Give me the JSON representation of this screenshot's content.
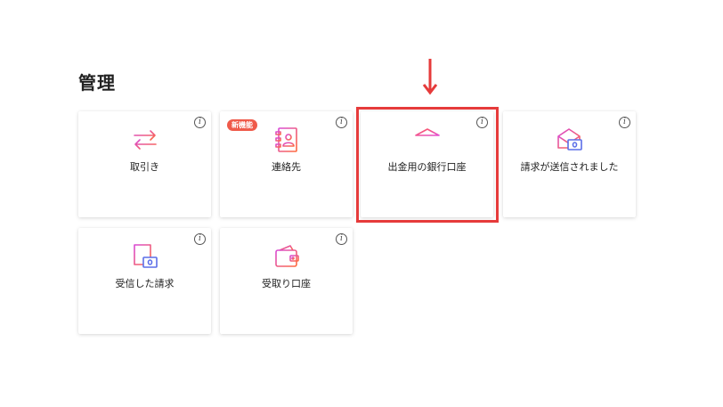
{
  "section": {
    "title": "管理"
  },
  "cards": [
    {
      "label": "取引き",
      "icon": "transfer-arrows-icon"
    },
    {
      "label": "連絡先",
      "icon": "contact-book-icon",
      "badge": "新機能"
    },
    {
      "label": "出金用の銀行口座",
      "icon": "bank-icon"
    },
    {
      "label": "請求が送信されました",
      "icon": "sent-invoice-envelope-icon"
    },
    {
      "label": "受信した請求",
      "icon": "received-invoice-icon"
    },
    {
      "label": "受取り口座",
      "icon": "wallet-icon"
    }
  ],
  "info_glyph": "i",
  "colors": {
    "accent_gradient_start": "#e34fd1",
    "accent_gradient_end": "#ff6a3d",
    "highlight": "#e63b3b",
    "badge": "#ef5a4a"
  }
}
